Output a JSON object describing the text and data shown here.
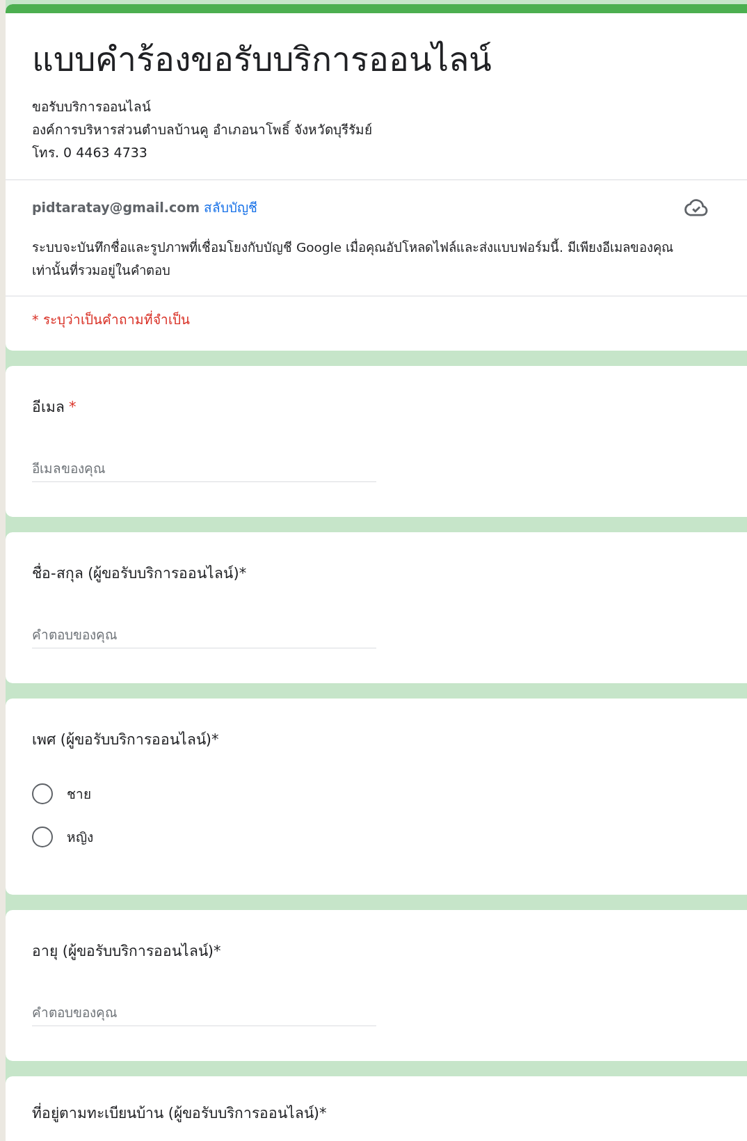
{
  "header": {
    "title": "แบบคำร้องขอรับบริการออนไลน์",
    "description": [
      "ขอรับบริการออนไลน์",
      "องค์การบริหารส่วนตำบลบ้านคู อำเภอนาโพธิ์ จังหวัดบุรีรัมย์",
      "โทร. 0 4463 4733"
    ]
  },
  "account": {
    "email": "pidtaratay@gmail.com",
    "switch_link": "สลับบัญชี",
    "notice": "ระบบจะบันทึกชื่อและรูปภาพที่เชื่อมโยงกับบัญชี Google เมื่อคุณอัปโหลดไฟล์และส่งแบบฟอร์มนี้. มีเพียงอีเมลของคุณเท่านั้นที่รวมอยู่ในคำตอบ"
  },
  "required_note": "* ระบุว่าเป็นคำถามที่จำเป็น",
  "questions": [
    {
      "kind": "text",
      "title": "อีเมล",
      "required_mark": "*",
      "placeholder": "อีเมลของคุณ"
    },
    {
      "kind": "text",
      "title": "ชื่อ-สกุล (ผู้ขอรับบริการออนไลน์)*",
      "placeholder": "คำตอบของคุณ"
    },
    {
      "kind": "radio",
      "title": "เพศ (ผู้ขอรับบริการออนไลน์)*",
      "options": [
        {
          "label": "ชาย",
          "selected": false
        },
        {
          "label": "หญิง",
          "selected": false
        }
      ]
    },
    {
      "kind": "text",
      "title": "อายุ (ผู้ขอรับบริการออนไลน์)*",
      "placeholder": "คำตอบของคุณ"
    },
    {
      "kind": "cut",
      "title": "ที่อยู่ตามทะเบียนบ้าน (ผู้ขอรับบริการออนไลน์)*"
    }
  ]
}
